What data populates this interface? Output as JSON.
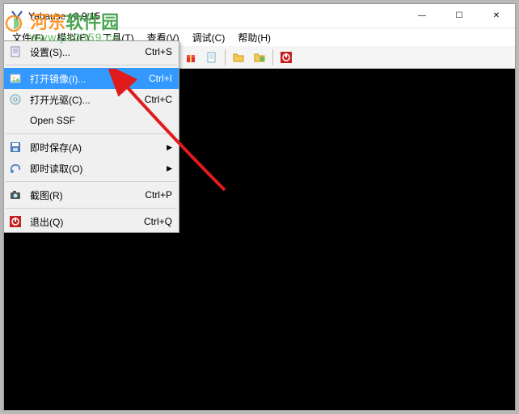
{
  "window": {
    "title": "Yabause v0.9.15",
    "controls": {
      "min": "—",
      "max": "☐",
      "close": "✕"
    }
  },
  "menubar": {
    "items": [
      {
        "label": "文件(F)"
      },
      {
        "label": "模拟(E)"
      },
      {
        "label": "工具(T)"
      },
      {
        "label": "查看(V)"
      },
      {
        "label": "调试(C)"
      },
      {
        "label": "帮助(H)"
      }
    ]
  },
  "toolbar": {
    "icons": [
      "cd-icon",
      "play-icon",
      "pause-icon",
      "reset-icon",
      "sep",
      "pad-icon",
      "monitor-icon",
      "clock-icon",
      "alarm-icon",
      "gift-icon",
      "page-icon",
      "sep",
      "folder-icon",
      "folder2-icon",
      "sep",
      "power-icon"
    ]
  },
  "dropdown": {
    "items": [
      {
        "icon": "settings-icon",
        "label": "设置(S)...",
        "shortcut": "Ctrl+S",
        "type": "item"
      },
      {
        "type": "sep"
      },
      {
        "icon": "image-icon",
        "label": "打开镜像(I)...",
        "shortcut": "Ctrl+I",
        "type": "item",
        "highlighted": true
      },
      {
        "icon": "cd-icon",
        "label": "打开光驱(C)...",
        "shortcut": "Ctrl+C",
        "type": "item"
      },
      {
        "icon": "",
        "label": "Open SSF",
        "shortcut": "",
        "type": "item"
      },
      {
        "type": "sep"
      },
      {
        "icon": "save-icon",
        "label": "即时保存(A)",
        "shortcut": "",
        "type": "submenu"
      },
      {
        "icon": "load-icon",
        "label": "即时读取(O)",
        "shortcut": "",
        "type": "submenu"
      },
      {
        "type": "sep"
      },
      {
        "icon": "camera-icon",
        "label": "截图(R)",
        "shortcut": "Ctrl+P",
        "type": "item"
      },
      {
        "type": "sep"
      },
      {
        "icon": "power-icon",
        "label": "退出(Q)",
        "shortcut": "Ctrl+Q",
        "type": "item"
      }
    ]
  },
  "watermark": {
    "brand_prefix": "河东",
    "brand_suffix": "软件园",
    "url": "www.pc0359.cn"
  },
  "colors": {
    "highlight": "#3399ff",
    "watermark_green": "#3b9e42",
    "watermark_orange": "#ff8c1a",
    "arrow_red": "#e01b1b"
  }
}
